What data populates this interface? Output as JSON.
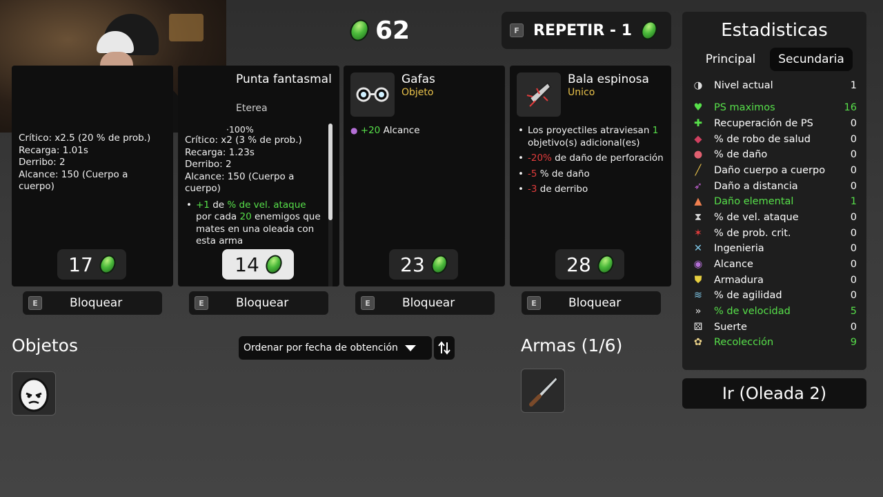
{
  "currency": {
    "value": "62",
    "icon": "material-icon"
  },
  "reroll": {
    "key": "F",
    "label": "REPETIR - 1"
  },
  "cards": [
    {
      "partial_stat": "·100%",
      "stats": [
        "Crítico: x2.5 (20 % de prob.)",
        "Recarga: 1.01s",
        "Derribo: 2",
        "Alcance: 150 (Cuerpo a cuerpo)"
      ],
      "price": "17"
    },
    {
      "name": "Punta fantasmal",
      "type": "Eterea",
      "stats": [
        "Crítico: x2 (3 % de prob.)",
        "Recarga: 1.23s",
        "Derribo: 2",
        "Alcance: 150 (Cuerpo a cuerpo)"
      ],
      "effect": {
        "plus": "+1",
        "de": " de ",
        "stat": "% de vel. ataque",
        "por_cada": " por cada ",
        "count": "20",
        "rest": " enemigos que mates en una oleada con esta arma"
      },
      "price": "14"
    },
    {
      "name": "Gafas",
      "type": "Objeto",
      "effect": {
        "value": "+20",
        "stat": " Alcance"
      },
      "price": "23"
    },
    {
      "name": "Bala espinosa",
      "type": "Unico",
      "effects": {
        "e1_a": "Los proyectiles atraviesan ",
        "e1_num": "1",
        "e1_b": " objetivo(s) adicional(es)",
        "e2_num": "-20%",
        "e2_b": " de daño de perforación",
        "e3_num": "-5",
        "e3_b": " % de daño",
        "e4_num": "-3",
        "e4_b": " de derribo"
      },
      "price": "28"
    }
  ],
  "lock": {
    "key": "E",
    "label": "Bloquear"
  },
  "items_section": {
    "title": "Objetos",
    "sort_label": "Ordenar por fecha de obtención"
  },
  "weapons_section": {
    "title": "Armas (1/6)"
  },
  "stats": {
    "title": "Estadisticas",
    "tabs": [
      "Principal",
      "Secundaria"
    ],
    "rows": [
      {
        "label": "Nivel actual",
        "value": "1",
        "icon": "level-icon",
        "color": "#ffffff"
      },
      {
        "label": "PS maximos",
        "value": "16",
        "icon": "heart-icon",
        "color": "#57e04a"
      },
      {
        "label": "Recuperación de PS",
        "value": "0",
        "icon": "regen-icon",
        "color": "#ffffff"
      },
      {
        "label": "% de robo de salud",
        "value": "0",
        "icon": "lifesteal-icon",
        "color": "#ffffff"
      },
      {
        "label": "% de daño",
        "value": "0",
        "icon": "damage-icon",
        "color": "#ffffff"
      },
      {
        "label": "Daño cuerpo a cuerpo",
        "value": "0",
        "icon": "melee-icon",
        "color": "#ffffff"
      },
      {
        "label": "Daño a distancia",
        "value": "0",
        "icon": "ranged-icon",
        "color": "#ffffff"
      },
      {
        "label": "Daño elemental",
        "value": "1",
        "icon": "elemental-icon",
        "color": "#57e04a"
      },
      {
        "label": "% de vel. ataque",
        "value": "0",
        "icon": "hourglass-icon",
        "color": "#ffffff"
      },
      {
        "label": "% de prob. crit.",
        "value": "0",
        "icon": "crit-icon",
        "color": "#ffffff"
      },
      {
        "label": "Ingenieria",
        "value": "0",
        "icon": "engineering-icon",
        "color": "#ffffff"
      },
      {
        "label": "Alcance",
        "value": "0",
        "icon": "range-icon",
        "color": "#ffffff"
      },
      {
        "label": "Armadura",
        "value": "0",
        "icon": "armor-icon",
        "color": "#ffffff"
      },
      {
        "label": "% de agilidad",
        "value": "0",
        "icon": "dodge-icon",
        "color": "#ffffff"
      },
      {
        "label": "% de velocidad",
        "value": "5",
        "icon": "speed-icon",
        "color": "#57e04a"
      },
      {
        "label": "Suerte",
        "value": "0",
        "icon": "luck-icon",
        "color": "#ffffff"
      },
      {
        "label": "Recolección",
        "value": "9",
        "icon": "harvest-icon",
        "color": "#57e04a"
      }
    ]
  },
  "go_button": {
    "label": "Ir (Oleada 2)"
  }
}
